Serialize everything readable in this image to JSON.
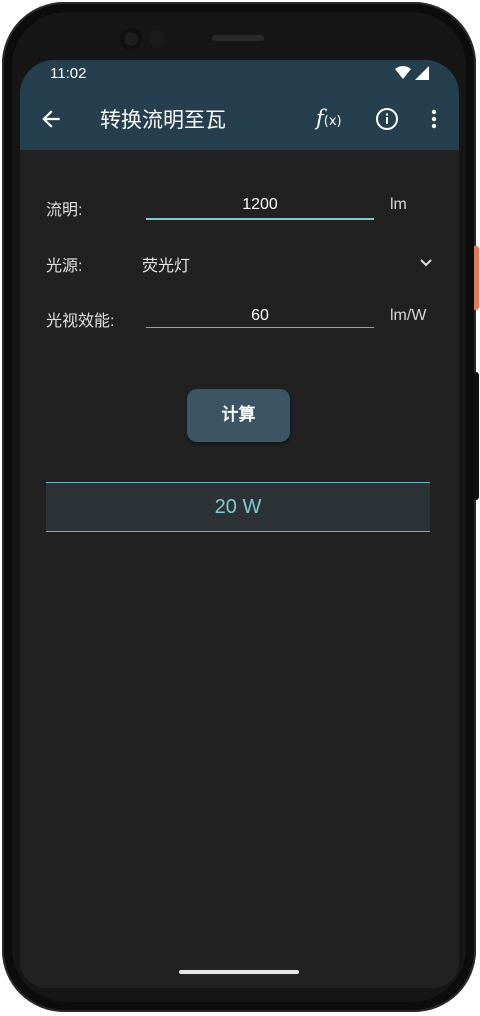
{
  "status": {
    "time": "11:02"
  },
  "toolbar": {
    "title": "转换流明至瓦",
    "fx_main": "f",
    "fx_sub": "(x)"
  },
  "form": {
    "flux": {
      "label": "流明:",
      "value": "1200",
      "unit": "lm"
    },
    "source": {
      "label": "光源:",
      "value": "荧光灯"
    },
    "efficacy": {
      "label": "光视效能:",
      "value": "60",
      "unit": "lm/W"
    }
  },
  "calculate_label": "计算",
  "result": "20 W",
  "colors": {
    "header": "#263f4e",
    "accent": "#7fcbce",
    "background": "#212121",
    "button": "#3c5565"
  },
  "icons": [
    "back-arrow-icon",
    "formula-icon",
    "info-icon",
    "more-vert-icon",
    "chevron-down-icon",
    "wifi-icon",
    "signal-icon"
  ]
}
